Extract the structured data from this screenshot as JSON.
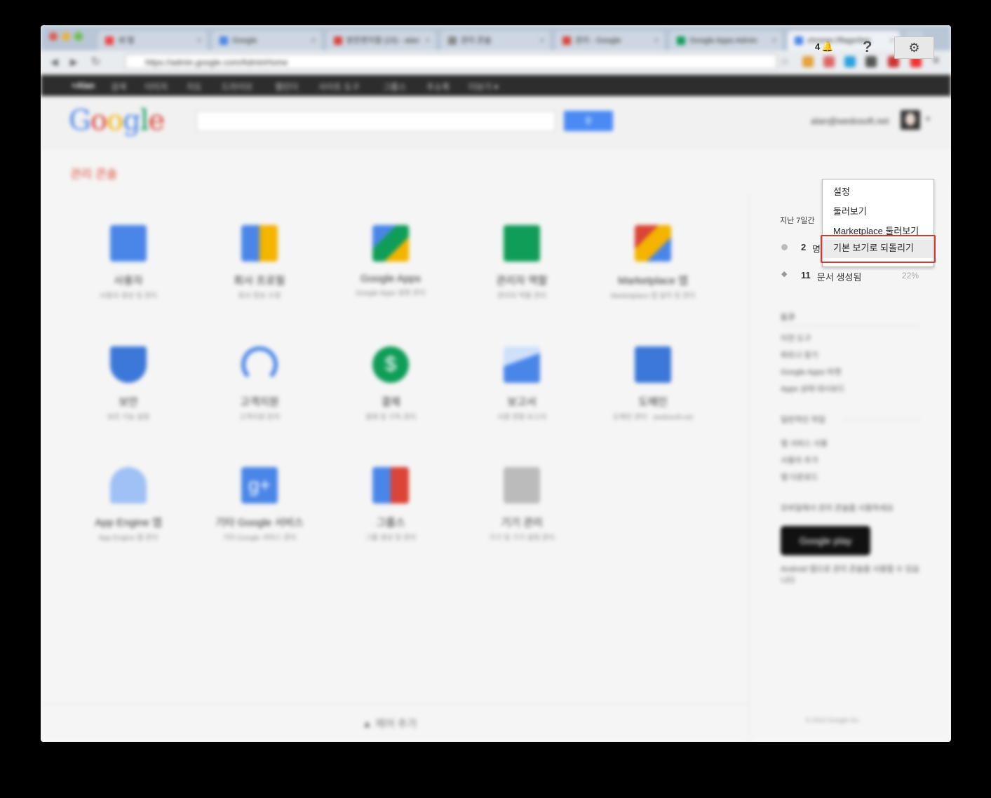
{
  "browser": {
    "tabs": [
      {
        "label": "새 탭",
        "active": false
      },
      {
        "label": "Google",
        "active": false
      },
      {
        "label": "받은편지함 (23) - alan",
        "active": false
      },
      {
        "label": "관리 콘솔",
        "active": false
      },
      {
        "label": "관리 - Google",
        "active": false
      },
      {
        "label": "Google Apps Admin",
        "active": false
      },
      {
        "label": "chrome://flags/#en",
        "active": true
      }
    ],
    "url": "https://admin.google.com/AdminHome",
    "gbar_items": [
      "+Alan",
      "검색",
      "이미지",
      "지도",
      "드라이브",
      "캘린더",
      "사이트 도구",
      "그룹스",
      "주소록",
      "더보기 ▾"
    ]
  },
  "header": {
    "logo": "Google",
    "search_button_icon": "search-icon",
    "account_email": "alan@wedosoft.net"
  },
  "toolbar": {
    "page_title": "관리 콘솔",
    "notification_count": "4",
    "help_label": "?"
  },
  "settings_menu": {
    "items": [
      "설정",
      "둘러보기",
      "Marketplace 둘러보기",
      "기본 보기로 되돌리기"
    ],
    "highlighted_index": 3
  },
  "apps": [
    {
      "title": "사용자",
      "desc": "사용자 생성 및 관리",
      "color": "#4a86e8"
    },
    {
      "title": "회사 프로필",
      "desc": "회사 정보 수정",
      "color": "#f4b400"
    },
    {
      "title": "Google Apps",
      "desc": "Google Apps 설정 관리",
      "color": "#0f9d58"
    },
    {
      "title": "관리자 역할",
      "desc": "관리자 역할 관리",
      "color": "#0f9d58"
    },
    {
      "title": "Marketplace 앱",
      "desc": "Marketplace 앱 설치 및 관리",
      "color": "#db4437"
    },
    {
      "title": "보안",
      "desc": "보안 기능 설정",
      "color": "#3c78d8"
    },
    {
      "title": "고객지원",
      "desc": "고객지원 문의",
      "color": "#4a86e8"
    },
    {
      "title": "결제",
      "desc": "결제 및 구독 관리",
      "color": "#0f9d58"
    },
    {
      "title": "보고서",
      "desc": "사용 현황 보고서",
      "color": "#4a86e8"
    },
    {
      "title": "도메인",
      "desc": "도메인 관리 · wedosoft.net",
      "color": "#3c78d8"
    },
    {
      "title": "App Engine 앱",
      "desc": "App Engine 앱 관리",
      "color": "#4a86e8"
    },
    {
      "title": "기타 Google 서비스",
      "desc": "기타 Google 서비스 관리",
      "color": "#4a86e8"
    },
    {
      "title": "그룹스",
      "desc": "그룹 생성 및 관리",
      "color": "#4a86e8"
    },
    {
      "title": "기기 관리",
      "desc": "기기 및 기기 설정 관리",
      "color": "#888888"
    }
  ],
  "footer": {
    "label": "▲ 제어 추가"
  },
  "right_panel": {
    "period_label": "지난 7일간",
    "stats": [
      {
        "value": "2",
        "label": "명"
      },
      {
        "value": "11",
        "label": "문서 생성됨",
        "pct": "22%"
      }
    ],
    "tools_heading": "도구",
    "tools": [
      "이전 도구",
      "파트너 찾기",
      "Google Apps 마켓",
      "Apps 상태 대시보드"
    ],
    "help_heading": "일반적인 작업",
    "help_links": [
      "앱 서비스 사용",
      "사용자 추가",
      "앱 다운로드"
    ],
    "mobile_promo": "모바일에서 관리 콘솔을 사용하세요",
    "play_badge": "Google play",
    "play_caption": "Android 앱으로 관리 콘솔을 사용할 수 있습니다",
    "copyright": "© 2013 Google Inc."
  }
}
